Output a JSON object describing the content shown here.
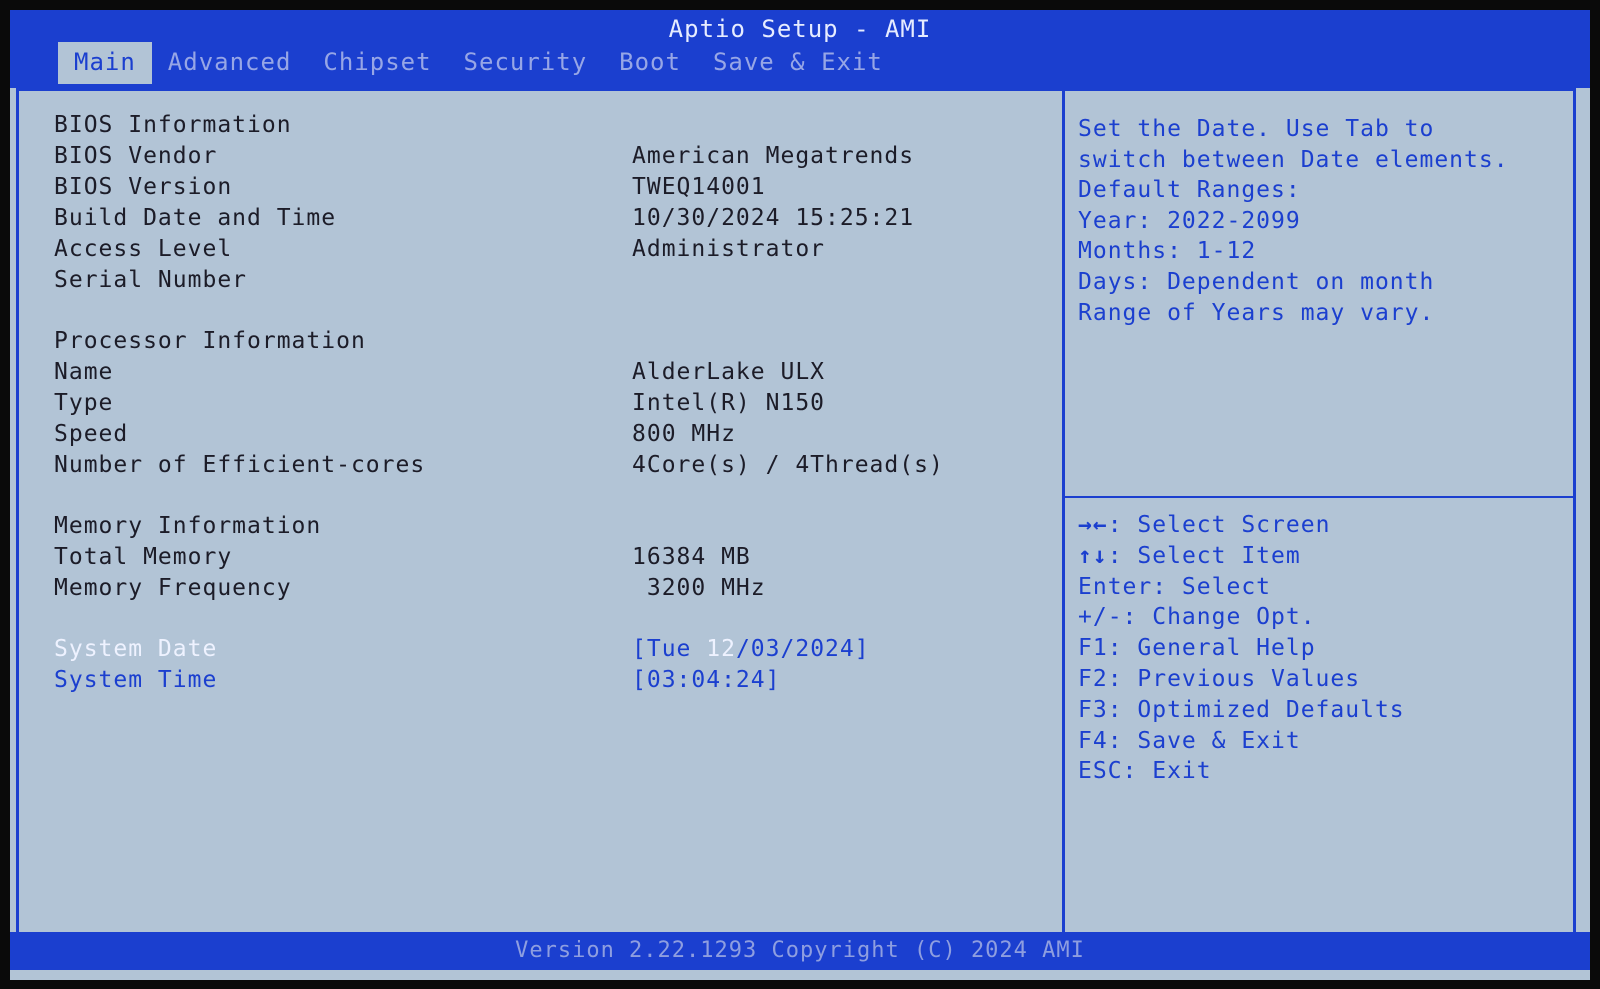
{
  "app": {
    "title": "Aptio Setup - AMI"
  },
  "tabs": [
    {
      "label": "Main",
      "active": true
    },
    {
      "label": "Advanced",
      "active": false
    },
    {
      "label": "Chipset",
      "active": false
    },
    {
      "label": "Security",
      "active": false
    },
    {
      "label": "Boot",
      "active": false
    },
    {
      "label": "Save & Exit",
      "active": false
    }
  ],
  "bios": {
    "section_title": "BIOS Information",
    "vendor": {
      "label": "BIOS Vendor",
      "value": "American Megatrends"
    },
    "version": {
      "label": "BIOS Version",
      "value": "TWEQ14001"
    },
    "build": {
      "label": "Build Date and Time",
      "value": "10/30/2024 15:25:21"
    },
    "access": {
      "label": "Access Level",
      "value": "Administrator"
    },
    "serial": {
      "label": "Serial Number",
      "value": ""
    }
  },
  "processor": {
    "section_title": "Processor Information",
    "name": {
      "label": "Name",
      "value": "AlderLake ULX"
    },
    "type": {
      "label": "Type",
      "value": "Intel(R) N150"
    },
    "speed": {
      "label": "Speed",
      "value": "800 MHz"
    },
    "cores": {
      "label": "Number of Efficient-cores",
      "value": "4Core(s) / 4Thread(s)"
    }
  },
  "memory": {
    "section_title": "Memory Information",
    "total": {
      "label": "Total Memory",
      "value": "16384 MB"
    },
    "frequency": {
      "label": "Memory Frequency",
      "value": " 3200 MHz"
    }
  },
  "system": {
    "date": {
      "label": "System Date",
      "prefix": "[Tue ",
      "highlighted": "12",
      "suffix": "/03/2024]"
    },
    "time": {
      "label": "System Time",
      "value": "[03:04:24]"
    }
  },
  "help": {
    "lines": [
      "Set the Date. Use Tab to",
      "switch between Date elements.",
      "Default Ranges:",
      "Year: 2022-2099",
      "Months: 1-12",
      "Days: Dependent on month",
      "Range of Years may vary."
    ]
  },
  "keys": [
    {
      "key": "→←",
      "desc": ": Select Screen"
    },
    {
      "key": "↑↓",
      "desc": ": Select Item"
    },
    {
      "key": "",
      "desc": "Enter: Select"
    },
    {
      "key": "",
      "desc": "+/-: Change Opt."
    },
    {
      "key": "",
      "desc": "F1: General Help"
    },
    {
      "key": "",
      "desc": "F2: Previous Values"
    },
    {
      "key": "",
      "desc": "F3: Optimized Defaults"
    },
    {
      "key": "",
      "desc": "F4: Save & Exit"
    },
    {
      "key": "",
      "desc": "ESC: Exit"
    }
  ],
  "footer": {
    "text": "Version 2.22.1293 Copyright (C) 2024 AMI"
  },
  "colors": {
    "accent_blue": "#1b3fcf",
    "panel_background": "#b2c4d6",
    "highlight_text": "#eef2ff"
  }
}
